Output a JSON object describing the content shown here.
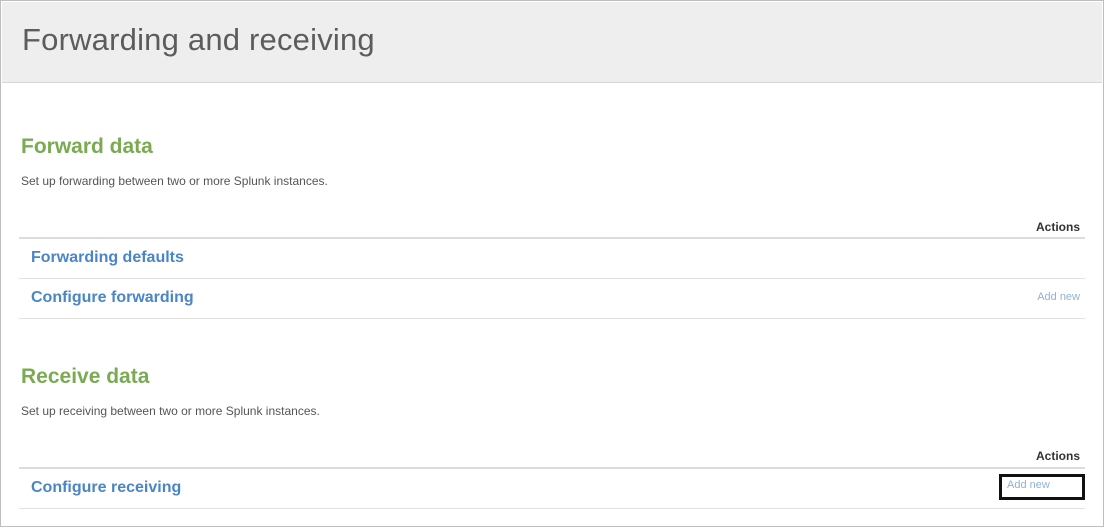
{
  "page": {
    "title": "Forwarding and receiving"
  },
  "forward": {
    "title": "Forward data",
    "description": "Set up forwarding between two or more Splunk instances.",
    "actions_header": "Actions",
    "rows": [
      {
        "label": "Forwarding defaults",
        "action": ""
      },
      {
        "label": "Configure forwarding",
        "action": "Add new"
      }
    ]
  },
  "receive": {
    "title": "Receive data",
    "description": "Set up receiving between two or more Splunk instances.",
    "actions_header": "Actions",
    "rows": [
      {
        "label": "Configure receiving",
        "action": "Add new"
      }
    ]
  }
}
